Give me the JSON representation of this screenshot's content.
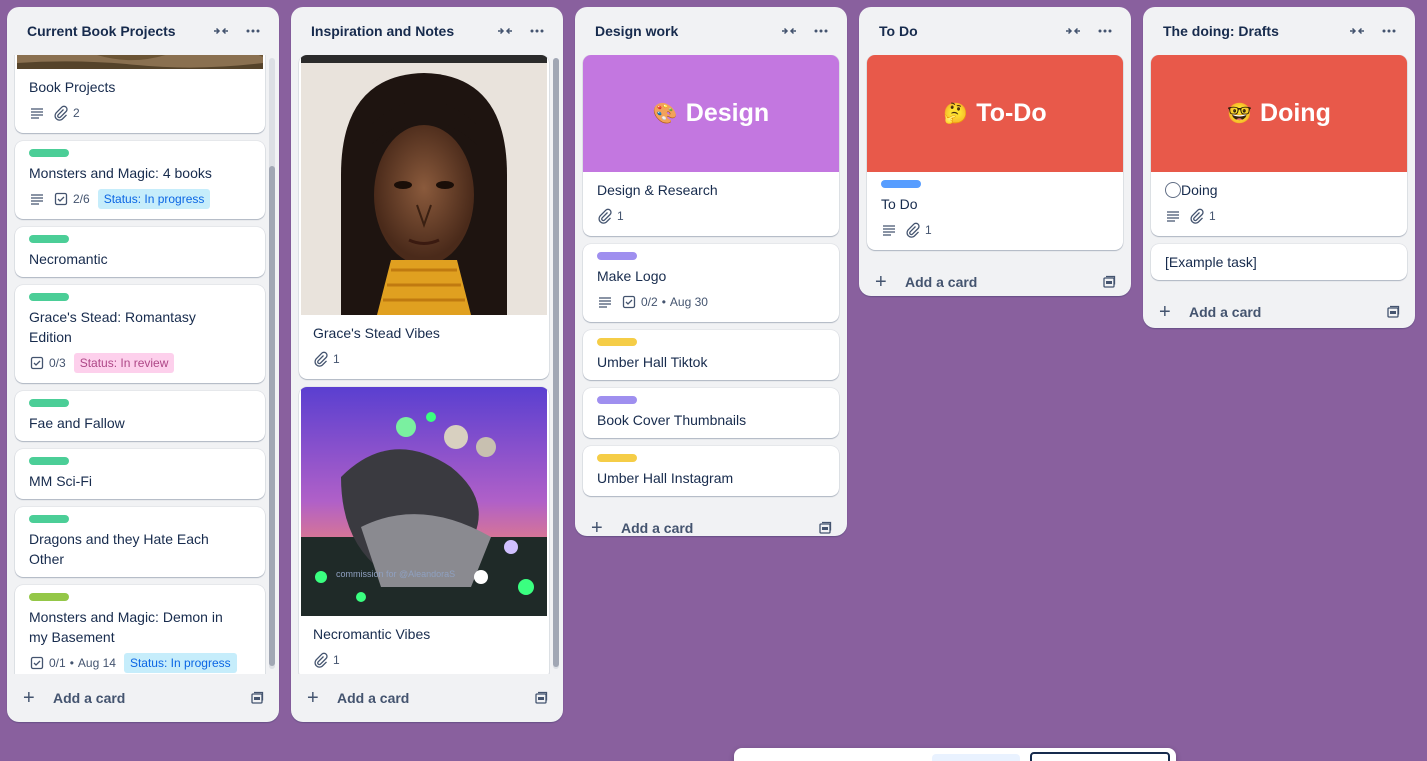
{
  "lists": [
    {
      "title": "Current Book Projects",
      "add_label": "Add a card",
      "cards": [
        {
          "title": "Book Projects",
          "attachments": "2"
        },
        {
          "title": "Monsters and Magic: 4 books",
          "checklist": "2/6",
          "status": "Status: In progress"
        },
        {
          "title": "Necromantic"
        },
        {
          "title": "Grace's Stead: Romantasy Edition",
          "checklist": "0/3",
          "status": "Status: In review"
        },
        {
          "title": "Fae and Fallow"
        },
        {
          "title": "MM Sci-Fi"
        },
        {
          "title": "Dragons and they Hate Each Other"
        },
        {
          "title": "Monsters and Magic: Demon in my Basement",
          "checklist": "0/1",
          "due": "Aug 14",
          "status": "Status: In progress"
        }
      ]
    },
    {
      "title": "Inspiration and Notes",
      "add_label": "Add a card",
      "cards": [
        {
          "title": "Grace's Stead Vibes",
          "attachments": "1"
        },
        {
          "title": "Necromantic Vibes",
          "attachments": "1",
          "cover_caption": "commission for @AleandoraS"
        }
      ]
    },
    {
      "title": "Design work",
      "add_label": "Add a card",
      "cover": {
        "emoji": "🎨",
        "text": "Design",
        "color": "#c377e0"
      },
      "cards": [
        {
          "title": "Design & Research",
          "attachments": "1"
        },
        {
          "title": "Make Logo",
          "checklist": "0/2",
          "due": "Aug 30"
        },
        {
          "title": "Umber Hall Tiktok"
        },
        {
          "title": "Book Cover Thumbnails"
        },
        {
          "title": "Umber Hall Instagram"
        }
      ]
    },
    {
      "title": "To Do",
      "add_label": "Add a card",
      "cover": {
        "emoji": "🤔",
        "text": "To-Do",
        "color": "#e8594a"
      },
      "cards": [
        {
          "title": "To Do",
          "attachments": "1"
        }
      ]
    },
    {
      "title": "The doing: Drafts",
      "add_label": "Add a card",
      "cover": {
        "emoji": "🤓",
        "text": "Doing",
        "color": "#e8594a"
      },
      "cards": [
        {
          "title": "Doing",
          "attachments": "1"
        },
        {
          "title": "[Example task]"
        }
      ]
    }
  ],
  "colors": {
    "board_bg": "#89609e",
    "label_green": "#4bce97",
    "label_lime": "#94c748",
    "label_purple": "#9f8fef",
    "label_yellow": "#f5cd47",
    "label_blue": "#579dff"
  }
}
